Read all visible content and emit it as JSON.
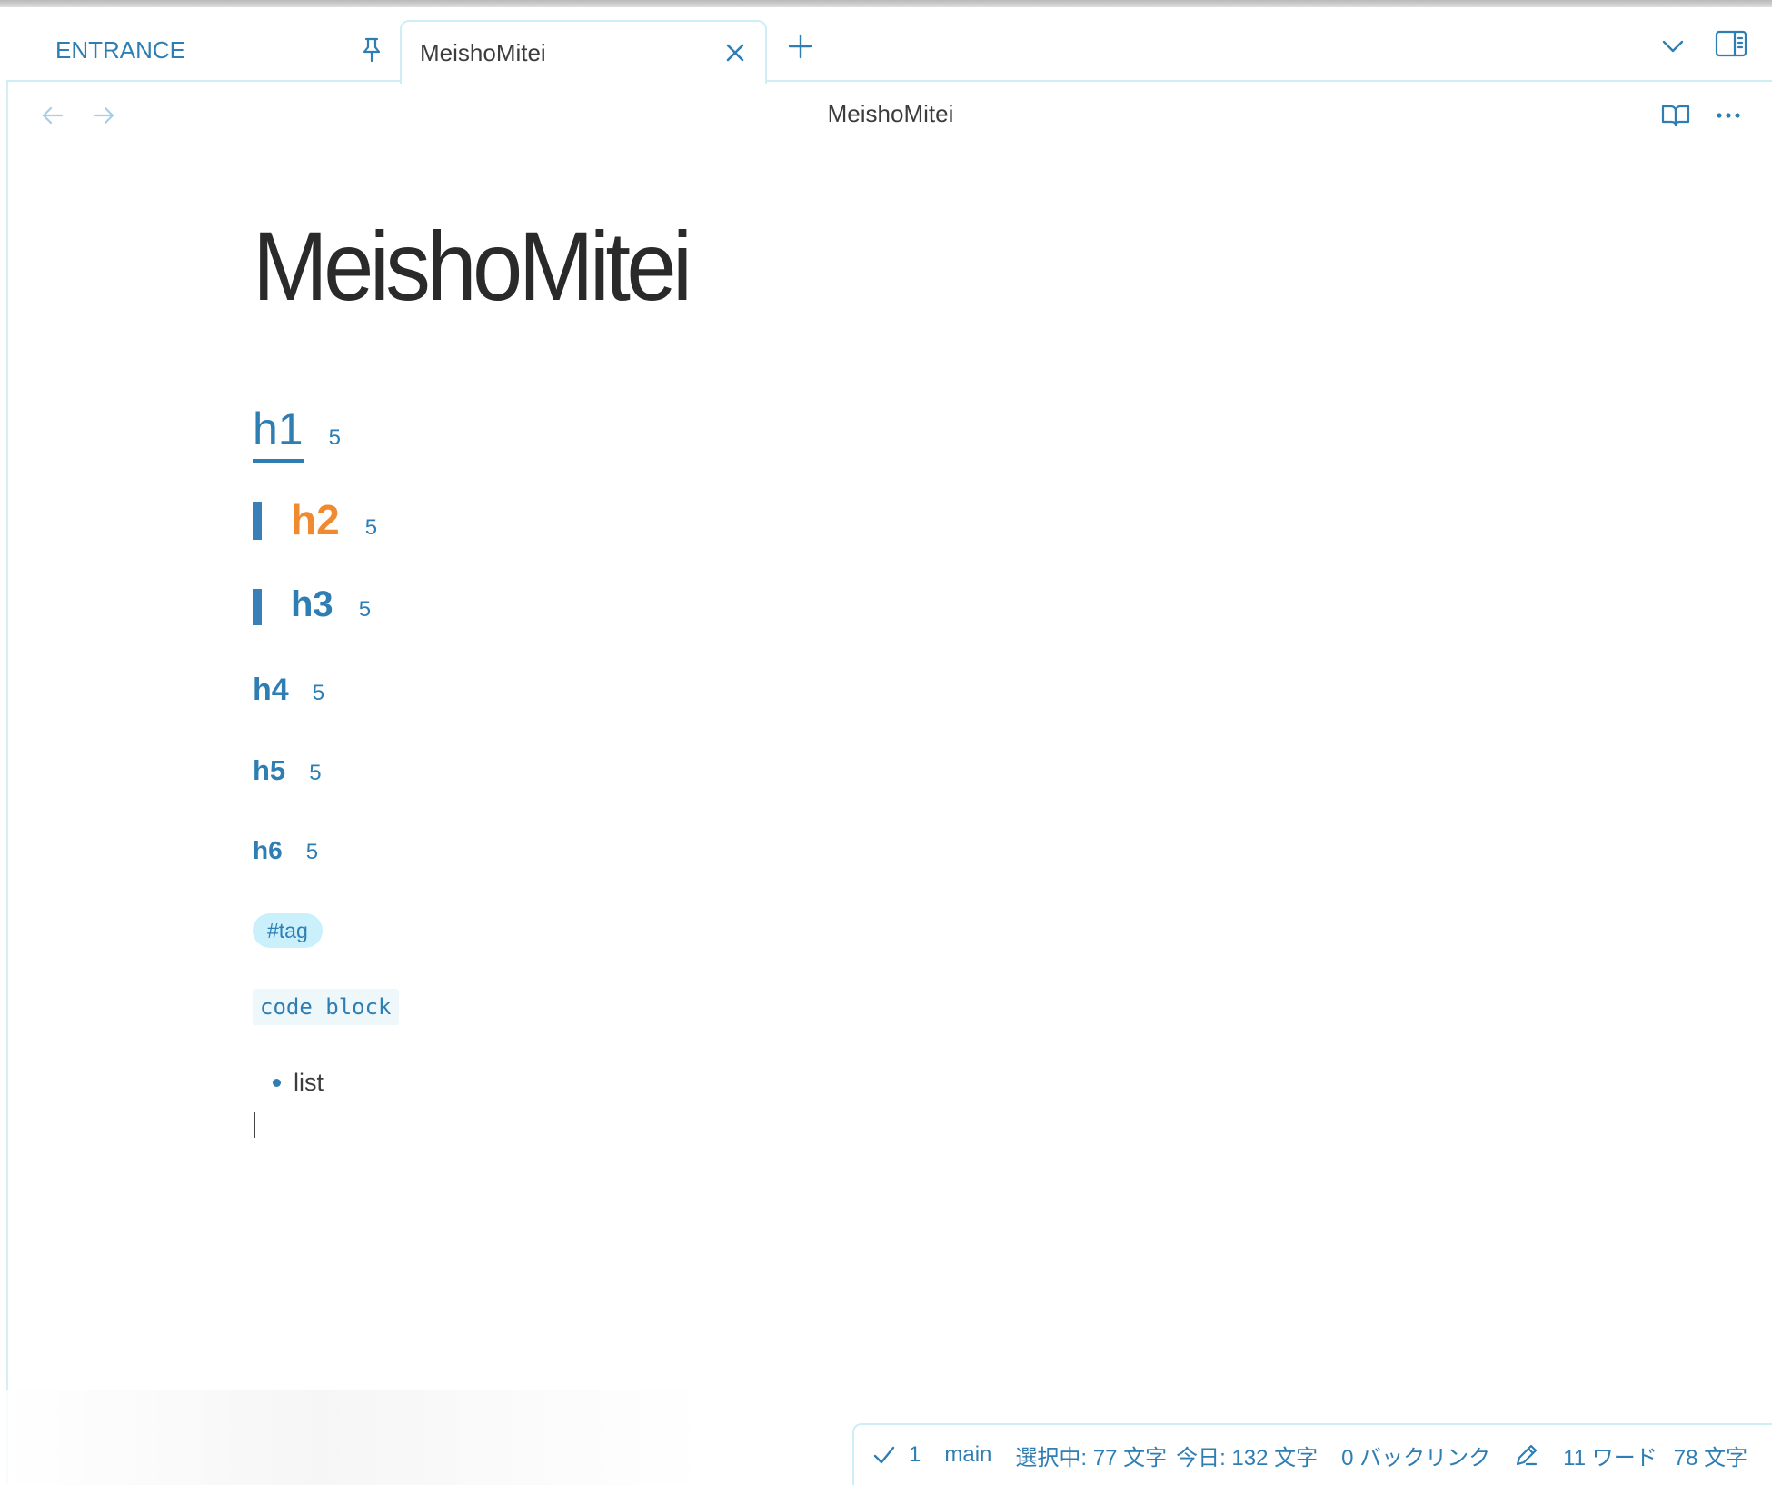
{
  "tabs": {
    "pinned": {
      "label": "ENTRANCE"
    },
    "active": {
      "label": "MeishoMitei"
    }
  },
  "view": {
    "title": "MeishoMitei"
  },
  "note": {
    "title": "MeishoMitei",
    "headings": [
      {
        "text": "h1",
        "count": "5"
      },
      {
        "text": "h2",
        "count": "5"
      },
      {
        "text": "h3",
        "count": "5"
      },
      {
        "text": "h4",
        "count": "5"
      },
      {
        "text": "h5",
        "count": "5"
      },
      {
        "text": "h6",
        "count": "5"
      }
    ],
    "tag": "#tag",
    "code": "code block",
    "list": [
      "list"
    ]
  },
  "status": {
    "sync_count": "1",
    "branch": "main",
    "selection": "選択中: 77 文字",
    "today": "今日: 132 文字",
    "backlinks": "0 バックリンク",
    "words": "11 ワード",
    "chars": "78 文字"
  },
  "colors": {
    "accent": "#2f7eb3",
    "h2": "#f08a30",
    "tag_bg": "#c9f0fb",
    "border": "#cdeef6"
  },
  "icons": {
    "pin": "pin-icon",
    "close": "close-icon",
    "new_tab": "plus-icon",
    "tab_list": "chevron-down-icon",
    "sidebar": "sidebar-toggle-icon",
    "back": "arrow-left-icon",
    "forward": "arrow-right-icon",
    "reading": "book-open-icon",
    "more": "more-horizontal-icon",
    "check": "check-icon",
    "pencil": "pencil-icon"
  }
}
